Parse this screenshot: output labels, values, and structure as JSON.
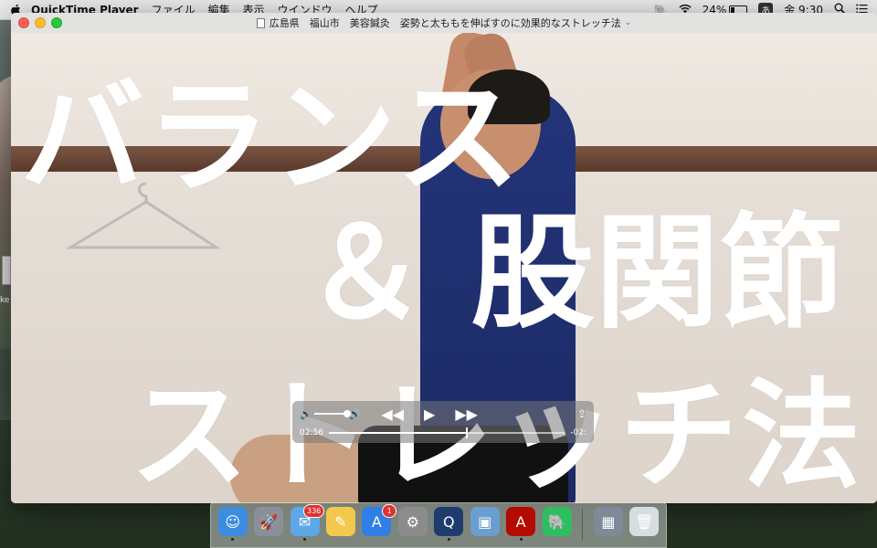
{
  "menubar": {
    "app_name": "QuickTime Player",
    "items": [
      "ファイル",
      "編集",
      "表示",
      "ウインドウ",
      "ヘルプ"
    ],
    "battery": "24%",
    "battery_level": 0.24,
    "ime": "あ",
    "clock": "金 9:30"
  },
  "window": {
    "title": "広島県　福山市　美容鍼灸　姿勢と太ももを伸ばすのに効果的なストレッチ法"
  },
  "video": {
    "overlay_line1": "バランス",
    "overlay_line2": "＆ 股関節",
    "overlay_line3": "ストレッチ法"
  },
  "controller": {
    "elapsed": "02:56",
    "remaining": "-02:",
    "progress": 0.58,
    "volume": 0.8
  },
  "desktop": {
    "icon_label": "ke"
  },
  "dock": {
    "apps": [
      {
        "name": "finder",
        "badge": "",
        "color": "#3b8de0",
        "glyph": "☺",
        "running": true
      },
      {
        "name": "launchpad",
        "badge": "",
        "color": "#8a8f99",
        "glyph": "🚀",
        "running": false
      },
      {
        "name": "mail",
        "badge": "336",
        "color": "#5fa8e8",
        "glyph": "✉",
        "running": true
      },
      {
        "name": "notes",
        "badge": "",
        "color": "#f2c94c",
        "glyph": "✎",
        "running": false
      },
      {
        "name": "app-store",
        "badge": "1",
        "color": "#2f7fe6",
        "glyph": "A",
        "running": false
      },
      {
        "name": "system-preferences",
        "badge": "",
        "color": "#8c8c8c",
        "glyph": "⚙",
        "running": false
      },
      {
        "name": "quicktime",
        "badge": "",
        "color": "#1f3c6e",
        "glyph": "Q",
        "running": true
      },
      {
        "name": "preview",
        "badge": "",
        "color": "#6b9ed0",
        "glyph": "▣",
        "running": false
      },
      {
        "name": "acrobat",
        "badge": "",
        "color": "#b30b00",
        "glyph": "A",
        "running": true
      },
      {
        "name": "evernote",
        "badge": "",
        "color": "#2dbe60",
        "glyph": "🐘",
        "running": false
      }
    ],
    "right": [
      {
        "name": "photo-folder",
        "color": "#7e8a99",
        "glyph": "▦"
      },
      {
        "name": "trash",
        "color": "#d8dde2",
        "glyph": "🗑"
      }
    ]
  }
}
